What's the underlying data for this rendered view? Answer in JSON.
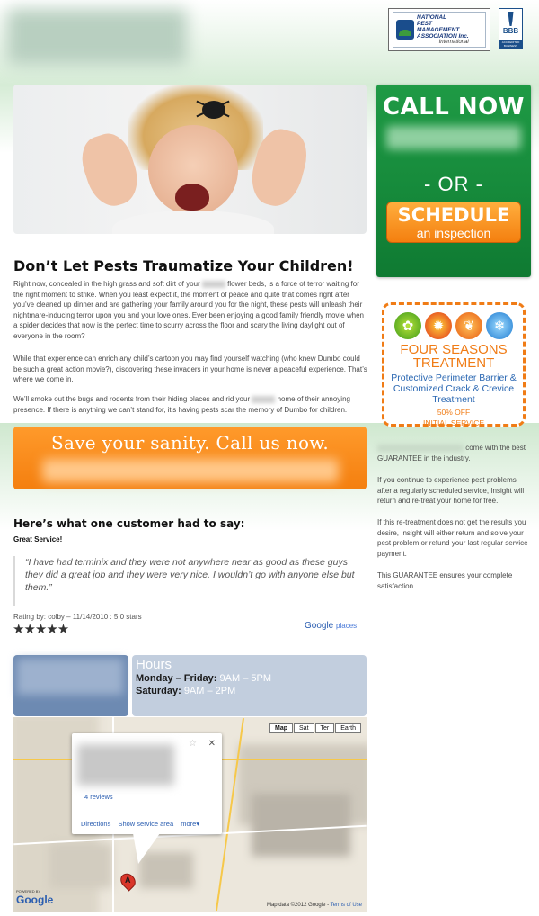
{
  "header": {
    "npma": {
      "line1": "NATIONAL",
      "line2": "PEST",
      "line3": "MANAGEMENT",
      "line4": "ASSOCIATION Inc.",
      "line5": "International"
    },
    "bbb": {
      "label": "BBB",
      "foot": "ACCREDITED BUSINESS"
    }
  },
  "cta": {
    "call_now": "CALL NOW",
    "or": "- OR -",
    "schedule": "SCHEDULE",
    "schedule_sub": "an inspection",
    "color": "#168a3b",
    "button_color": "#f47f0f"
  },
  "coupon": {
    "title_line1": "FOUR SEASONS",
    "title_line2": "TREATMENT",
    "desc": "Protective Perimeter Barrier & Customized Crack & Crevice Treatment",
    "off": "50% OFF",
    "initial": "INITIAL SERVICE",
    "icons": [
      "spring-icon",
      "summer-icon",
      "fall-icon",
      "winter-icon"
    ],
    "accent": "#f07c16"
  },
  "main": {
    "headline": "Don’t Let Pests Traumatize Your Children!",
    "p1_a": "Right now, concealed in the high grass and soft dirt of your",
    "p1_b": "flower beds, is a force of terror waiting for the right moment to strike. When you least expect it, the moment of peace and quite that comes right after you’ve cleaned up dinner and are gathering your family around you for the night, these pests will unleash their nightmare-inducing terror upon you and your love ones. Ever been enjoying a good family friendly movie when a spider decides that now is the perfect time to scurry across the floor and scary the living daylight out of everyone in the room?",
    "p2": "While that experience can enrich any child’s cartoon you may find yourself watching (who knew Dumbo could be such a great action movie?), discovering these invaders in your home is never a peaceful experience. That’s where we come in.",
    "p3_a": "We’ll smoke out the bugs and rodents from their hiding places and rid your",
    "p3_b": "home of their annoying presence. If there is anything we can’t stand for, it’s having pests scar the memory of Dumbo for children."
  },
  "banner": {
    "title": "Save your sanity. Call us now."
  },
  "guarantee": {
    "g1_tail": "come with the best GUARANTEE in the industry.",
    "g2": "If you continue to experience pest problems after a regularly scheduled service, Insight will return and re-treat your home for free.",
    "g3": "If this re-treatment does not get the results you desire, Insight will either return and solve your pest problem or refund your last regular service payment.",
    "g4": "This GUARANTEE ensures your complete satisfaction."
  },
  "testimonial": {
    "heading": "Here’s what one customer had to say:",
    "subject": "Great Service!",
    "quote": "“I have had terminix and they were not anywhere near as good as these guys they did a great job and they were very nice. I wouldn’t go with anyone else but them.”",
    "rating": "Rating by: colby – 11/14/2010 : 5.0 stars",
    "stars": "★★★★★",
    "google_places": {
      "g": "Google",
      "places": "places"
    }
  },
  "hours": {
    "title": "Hours",
    "weekday_label": "Monday – Friday:",
    "weekday_time": "9AM – 5PM",
    "saturday_label": "Saturday:",
    "saturday_time": "9AM – 2PM"
  },
  "map": {
    "types": [
      "Map",
      "Sat",
      "Ter",
      "Earth"
    ],
    "reviews": "4 reviews",
    "links": [
      "Directions",
      "Show service area",
      "more▾"
    ],
    "marker": "A",
    "powered_by": "POWERED BY",
    "google": "Google",
    "data": "Map data ©2012 Google -",
    "terms": "Terms of Use"
  }
}
